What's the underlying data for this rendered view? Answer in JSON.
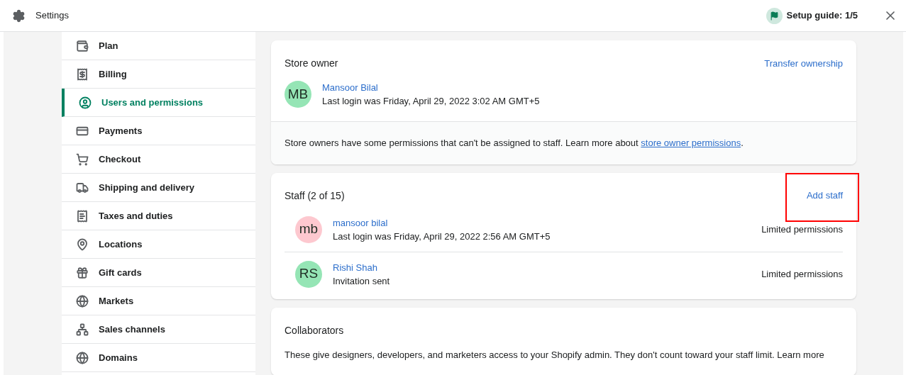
{
  "header": {
    "title": "Settings",
    "setup_guide": "Setup guide: 1/5"
  },
  "sidebar": {
    "items": [
      {
        "label": "Plan",
        "selected": false
      },
      {
        "label": "Billing",
        "selected": false
      },
      {
        "label": "Users and permissions",
        "selected": true
      },
      {
        "label": "Payments",
        "selected": false
      },
      {
        "label": "Checkout",
        "selected": false
      },
      {
        "label": "Shipping and delivery",
        "selected": false
      },
      {
        "label": "Taxes and duties",
        "selected": false
      },
      {
        "label": "Locations",
        "selected": false
      },
      {
        "label": "Gift cards",
        "selected": false
      },
      {
        "label": "Markets",
        "selected": false
      },
      {
        "label": "Sales channels",
        "selected": false
      },
      {
        "label": "Domains",
        "selected": false
      }
    ]
  },
  "store_owner": {
    "title": "Store owner",
    "action": "Transfer ownership",
    "owner": {
      "initials": "MB",
      "name": "Mansoor Bilal",
      "detail": "Last login was Friday, April 29, 2022 3:02 AM GMT+5",
      "color": "#95e5b5"
    },
    "note": "Store owners have some permissions that can't be assigned to staff. Learn more about ",
    "note_link": "store owner permissions",
    "note_end": "."
  },
  "staff": {
    "title": "Staff (2 of 15)",
    "action": "Add staff",
    "action_highlighted": true,
    "members": [
      {
        "initials": "mb",
        "name": "mansoor bilal",
        "detail": "Last login was Friday, April 29, 2022 2:56 AM GMT+5",
        "permissions": "Limited permissions",
        "color": "#fdc8cf"
      },
      {
        "initials": "RS",
        "name": "Rishi Shah",
        "detail": "Invitation sent",
        "permissions": "Limited permissions",
        "color": "#95e5b5"
      }
    ]
  },
  "collaborators": {
    "title": "Collaborators",
    "text": "These give designers, developers, and marketers access to your Shopify admin. They don't count toward your staff limit. Learn more"
  }
}
